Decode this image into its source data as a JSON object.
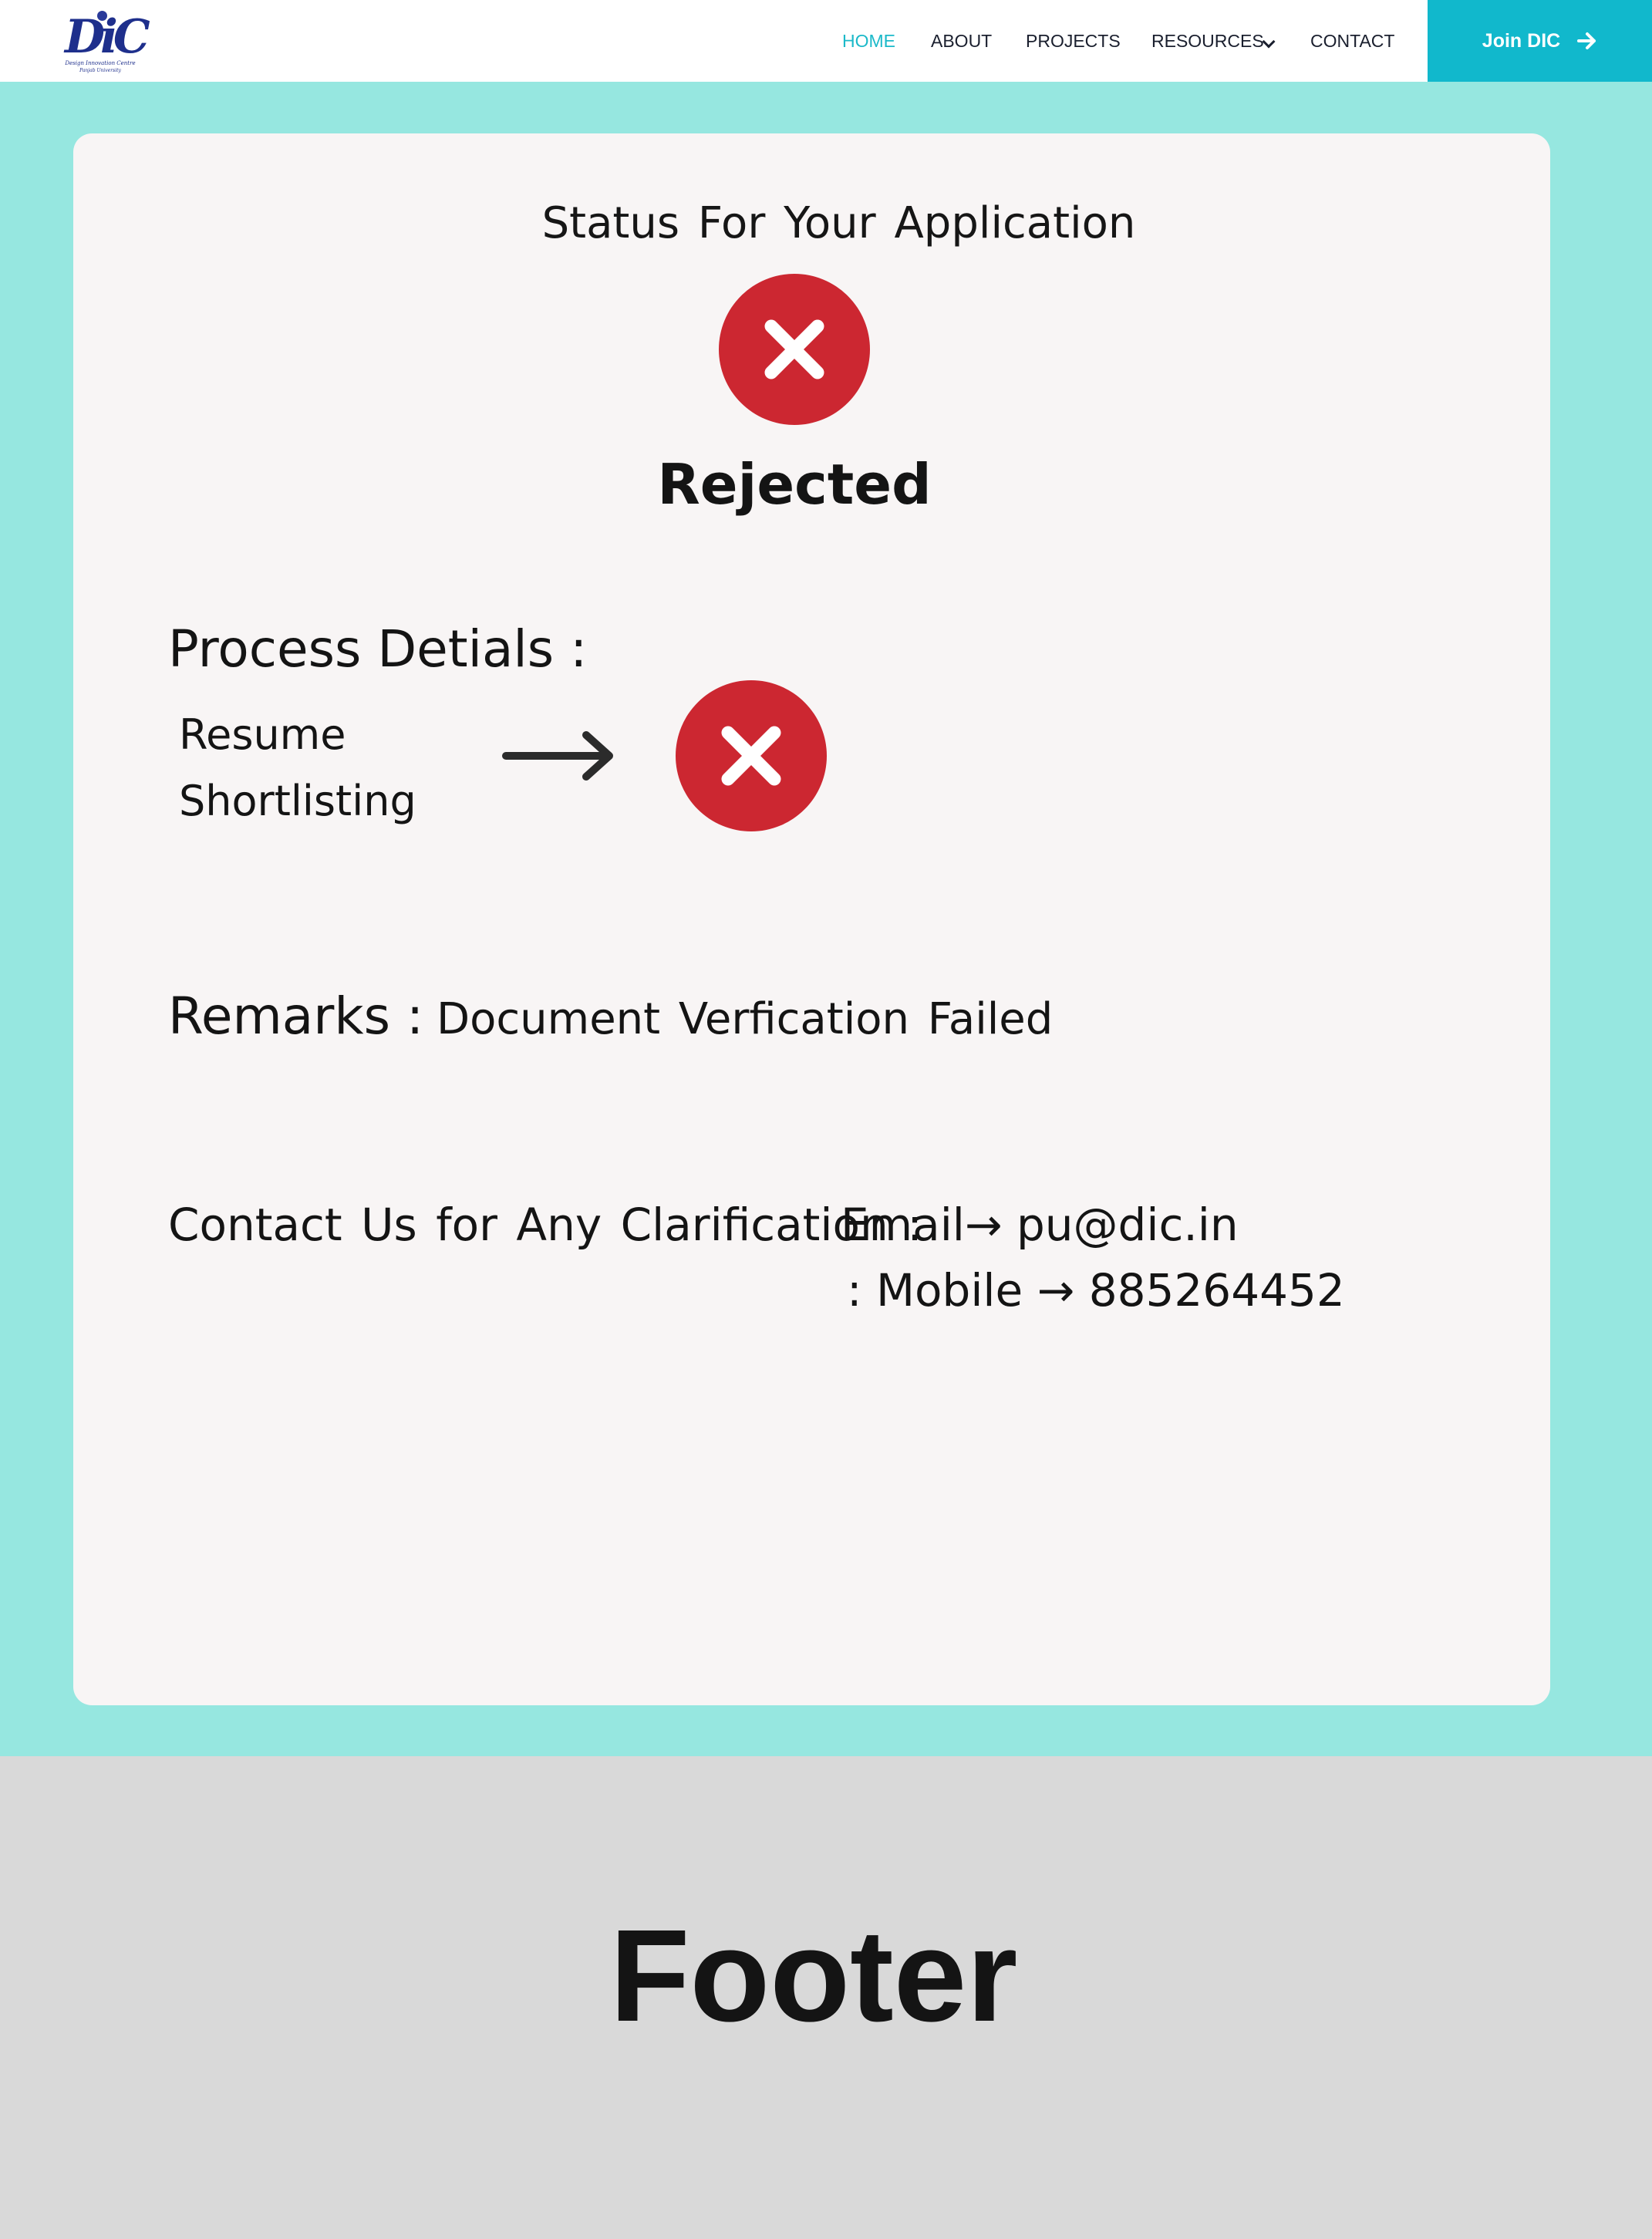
{
  "brand": {
    "logo_letters": "DiC",
    "logo_line1": "Design Innovation Centre",
    "logo_line2": "Panjab University"
  },
  "nav": {
    "home": "HOME",
    "about": "ABOUT",
    "projects": "PROJECTS",
    "resources": "RESOURCES",
    "contact": "CONTACT",
    "active": "HOME"
  },
  "cta": {
    "join_label": "Join DIC"
  },
  "status": {
    "title": "Status For Your Application",
    "result": "Rejected",
    "result_icon": "x-circle-icon",
    "color_rejected": "#cc2731"
  },
  "process": {
    "heading": "Process Detials :",
    "steps": [
      {
        "label": "Resume Shortlisting",
        "state": "rejected"
      }
    ]
  },
  "remarks": {
    "label": "Remarks :",
    "value": "Document Verfication Failed"
  },
  "contact": {
    "label": "Contact Us for Any Clarification :",
    "email": "Email→ pu@dic.in",
    "mobile": ":  Mobile → 885264452"
  },
  "footer": {
    "text": "Footer"
  },
  "colors": {
    "background": "#96e7e0",
    "accent": "#11b8cc",
    "card": "#f8f5f5",
    "footer": "#d9d9d9"
  }
}
